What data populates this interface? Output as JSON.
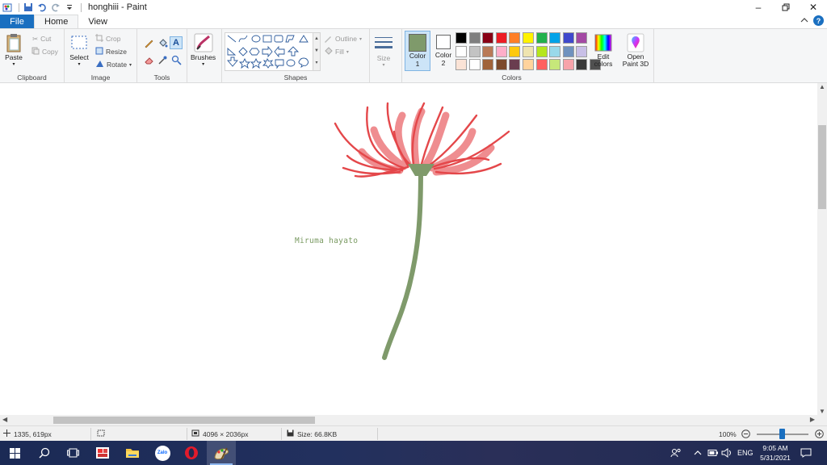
{
  "window": {
    "title": "honghiii - Paint",
    "controls": [
      "minimize-icon",
      "restore-icon",
      "close-icon"
    ]
  },
  "menu": {
    "tabs": [
      {
        "label": "File"
      },
      {
        "label": "Home"
      },
      {
        "label": "View"
      }
    ]
  },
  "ribbon": {
    "clipboard": {
      "label": "Clipboard",
      "paste": "Paste",
      "cut": "Cut",
      "copy": "Copy"
    },
    "image": {
      "label": "Image",
      "select": "Select",
      "crop": "Crop",
      "resize": "Resize",
      "rotate": "Rotate"
    },
    "tools": {
      "label": "Tools"
    },
    "brushes": {
      "label": "Brushes"
    },
    "shapes": {
      "label": "Shapes",
      "outline": "Outline",
      "fill": "Fill"
    },
    "size": {
      "label": "Size"
    },
    "colors": {
      "label": "Colors",
      "color1_label": "Color",
      "color1_num": "1",
      "color1_value": "#7f9a6b",
      "color2_label": "Color",
      "color2_num": "2",
      "color2_value": "#ffffff",
      "edit_label": "Edit colors",
      "palette": [
        [
          "#000000",
          "#7f7f7f",
          "#880015",
          "#ed1c24",
          "#ff7f27",
          "#fff200",
          "#22b14c",
          "#00a2e8",
          "#3f48cc",
          "#a349a4"
        ],
        [
          "#ffffff",
          "#c3c3c3",
          "#b97a57",
          "#ffaec9",
          "#ffc90e",
          "#efe4b0",
          "#b5e61d",
          "#99d9ea",
          "#7092be",
          "#c8bfe7"
        ],
        [
          "#fbe3d6",
          "#ffffff",
          "#a0633a",
          "#7c4a2b",
          "#6a3d4f",
          "#ffd39c",
          "#ff6060",
          "#c6e87a",
          "#f7a3aa",
          "#3a3a3a",
          "#505050"
        ]
      ]
    },
    "paint3d": {
      "label": "Open Paint 3D"
    }
  },
  "canvas": {
    "signature": "Miruma hayato",
    "petal_color": "#e4474a",
    "petal_light_color": "#ef8d90",
    "stem_color": "#7f9a6b"
  },
  "status": {
    "cursor": "1335, 619px",
    "image_size": "4096 × 2036px",
    "file_size": "Size: 66.8KB",
    "zoom": "100%"
  },
  "taskbar": {
    "apps": [
      "windows-start-icon",
      "search-icon",
      "task-view-icon",
      "app-photos-icon",
      "file-explorer-icon",
      "zalo-icon",
      "opera-icon",
      "paint-icon"
    ],
    "zalo_text": "Zalo",
    "language": "ENG",
    "time": "9:05 AM",
    "date": "5/31/2021"
  }
}
